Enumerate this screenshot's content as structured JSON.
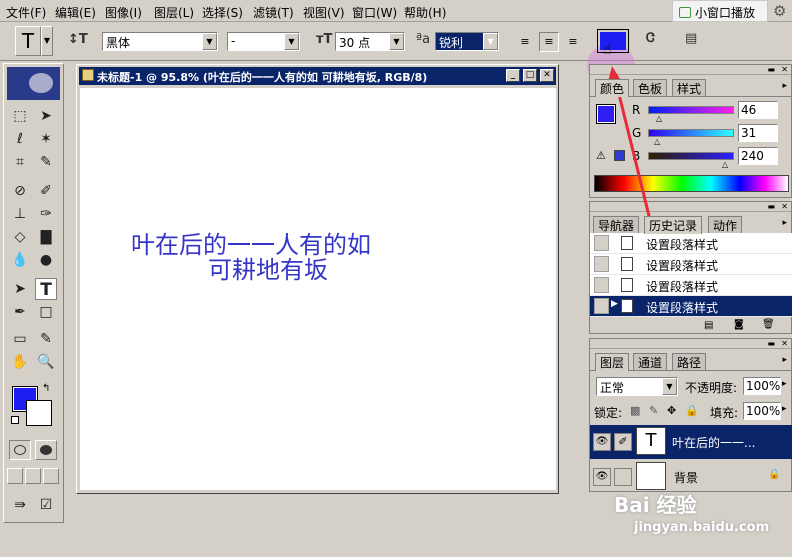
{
  "menu": {
    "items": [
      "文件(F)",
      "编辑(E)",
      "图像(I)",
      "图层(L)",
      "选择(S)",
      "滤镜(T)",
      "视图(V)",
      "窗口(W)",
      "帮助(H)"
    ],
    "mini_play": "小窗口播放"
  },
  "options": {
    "font_family": "黑体",
    "font_style": "-",
    "font_size": "30 点",
    "antialias": "锐利",
    "text_color": "#1e1ef0"
  },
  "document": {
    "title": "未标题-1 @ 95.8% (叶在后的一一人有的如 可耕地有坂, RGB/8)",
    "line1": "叶在后的一一人有的如",
    "line2": "可耕地有坂"
  },
  "color_palette": {
    "tabs": [
      "颜色",
      "色板",
      "样式"
    ],
    "r_label": "R",
    "r_value": "46",
    "g_label": "G",
    "g_value": "31",
    "b_label": "B",
    "b_value": "240",
    "swatch_color": "#2e1ff0"
  },
  "history_palette": {
    "tabs": [
      "导航器",
      "历史记录",
      "动作"
    ],
    "items": [
      "设置段落样式",
      "设置段落样式",
      "设置段落样式",
      "设置段落样式"
    ]
  },
  "layers_palette": {
    "tabs": [
      "图层",
      "通道",
      "路径"
    ],
    "blend_mode": "正常",
    "opacity_label": "不透明度:",
    "opacity_value": "100%",
    "lock_label": "锁定:",
    "fill_label": "填充:",
    "fill_value": "100%",
    "layers": [
      {
        "name": "叶在后的一一...",
        "thumb": "T"
      },
      {
        "name": "背景",
        "thumb": ""
      }
    ]
  },
  "watermark": {
    "brand": "Bai 经验",
    "url": "jingyan.baidu.com"
  }
}
